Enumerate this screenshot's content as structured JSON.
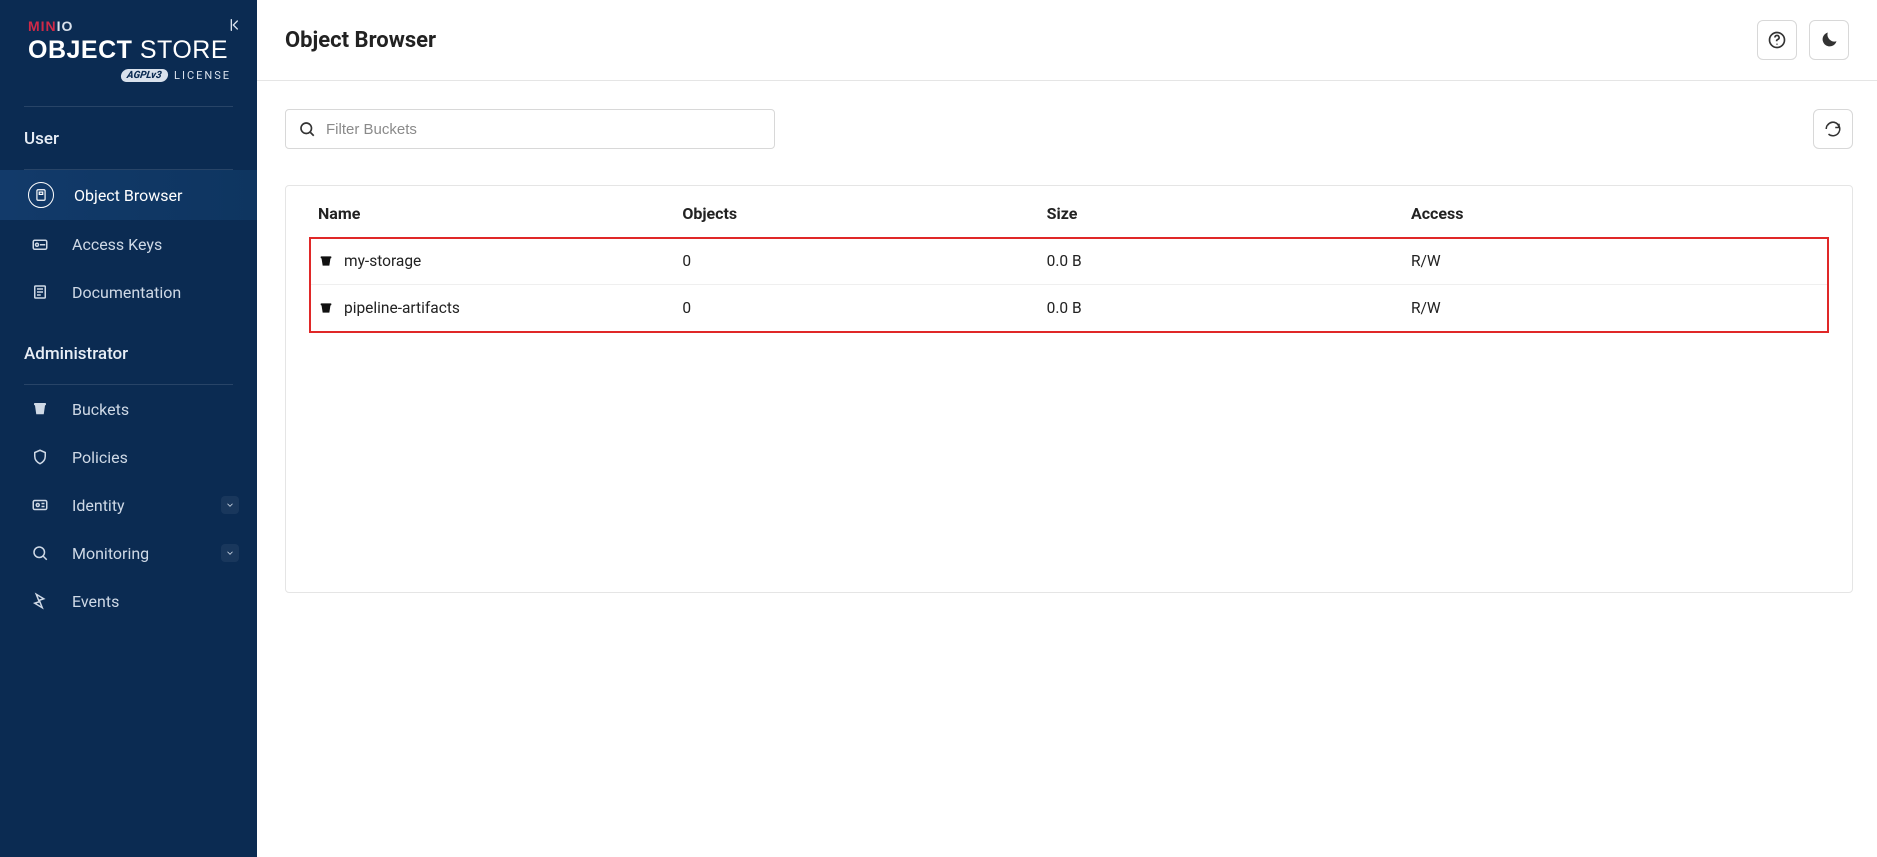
{
  "brand": {
    "name_prefix": "MIN",
    "name_suffix": "IO",
    "title_bold": "OBJECT",
    "title_light": "STORE",
    "license_badge": "AGPLv3",
    "license_label": "LICENSE"
  },
  "sidebar": {
    "sections": [
      {
        "title": "User",
        "items": [
          {
            "label": "Object Browser",
            "icon": "object-browser-icon",
            "active": true,
            "expandable": false
          },
          {
            "label": "Access Keys",
            "icon": "access-keys-icon",
            "active": false,
            "expandable": false
          },
          {
            "label": "Documentation",
            "icon": "documentation-icon",
            "active": false,
            "expandable": false
          }
        ]
      },
      {
        "title": "Administrator",
        "items": [
          {
            "label": "Buckets",
            "icon": "bucket-icon",
            "active": false,
            "expandable": false
          },
          {
            "label": "Policies",
            "icon": "policies-icon",
            "active": false,
            "expandable": false
          },
          {
            "label": "Identity",
            "icon": "identity-icon",
            "active": false,
            "expandable": true
          },
          {
            "label": "Monitoring",
            "icon": "monitoring-icon",
            "active": false,
            "expandable": true
          },
          {
            "label": "Events",
            "icon": "events-icon",
            "active": false,
            "expandable": false
          }
        ]
      }
    ]
  },
  "header": {
    "title": "Object Browser"
  },
  "filter": {
    "placeholder": "Filter Buckets",
    "value": ""
  },
  "table": {
    "columns": [
      "Name",
      "Objects",
      "Size",
      "Access"
    ],
    "rows": [
      {
        "name": "my-storage",
        "objects": "0",
        "size": "0.0 B",
        "access": "R/W"
      },
      {
        "name": "pipeline-artifacts",
        "objects": "0",
        "size": "0.0 B",
        "access": "R/W"
      }
    ]
  }
}
